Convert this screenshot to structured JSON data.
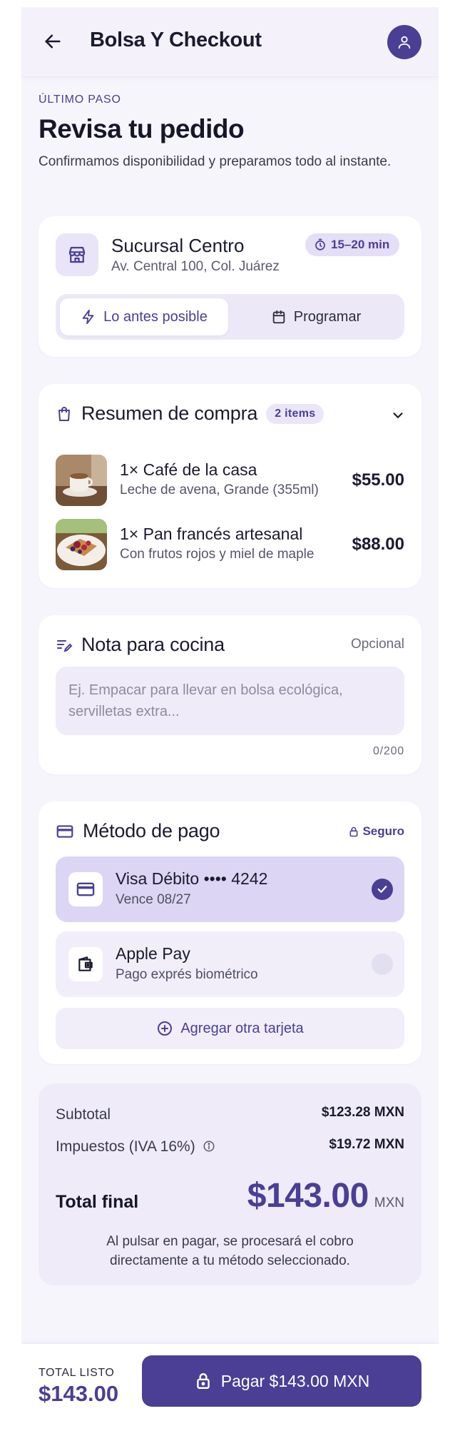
{
  "header": {
    "title": "Bolsa Y Checkout"
  },
  "intro": {
    "eyebrow": "ÚLTIMO PASO",
    "title": "Revisa tu pedido",
    "subtitle": "Confirmamos disponibilidad y preparamos todo al instante."
  },
  "store": {
    "name": "Sucursal Centro",
    "address": "Av. Central 100, Col. Juárez",
    "eta": "15–20 min",
    "options": [
      {
        "label": "Lo antes posible",
        "selected": true
      },
      {
        "label": "Programar",
        "selected": false
      }
    ]
  },
  "summary": {
    "title": "Resumen de compra",
    "count": "2 items",
    "items": [
      {
        "name": "1× Café de la casa",
        "desc": "Leche de avena, Grande (355ml)",
        "price": "$55.00"
      },
      {
        "name": "1× Pan francés artesanal",
        "desc": "Con frutos rojos y miel de maple",
        "price": "$88.00"
      }
    ]
  },
  "note": {
    "title": "Nota para cocina",
    "optional": "Opcional",
    "placeholder": "Ej. Empacar para llevar en bolsa ecológica, servilletas extra...",
    "counter": "0/200"
  },
  "payment": {
    "title": "Método de pago",
    "secure": "Seguro",
    "methods": [
      {
        "name": "Visa Débito •••• 4242",
        "sub": "Vence 08/27",
        "selected": true
      },
      {
        "name": "Apple Pay",
        "sub": "Pago exprés biométrico",
        "selected": false
      }
    ],
    "add": "Agregar otra tarjeta"
  },
  "totals": {
    "subtotal_label": "Subtotal",
    "subtotal": "$123.28 MXN",
    "tax_label": "Impuestos (IVA 16%)",
    "tax": "$19.72 MXN",
    "final_label": "Total final",
    "final": "$143.00",
    "currency": "MXN",
    "legal": "Al pulsar en pagar, se procesará el cobro directamente a tu método seleccionado."
  },
  "bottom": {
    "label": "TOTAL LISTO",
    "amount": "$143.00",
    "pay_button": "Pagar $143.00 MXN"
  },
  "colors": {
    "accent": "#4a3f94",
    "background": "#f7f5fc",
    "card": "#ffffff"
  }
}
